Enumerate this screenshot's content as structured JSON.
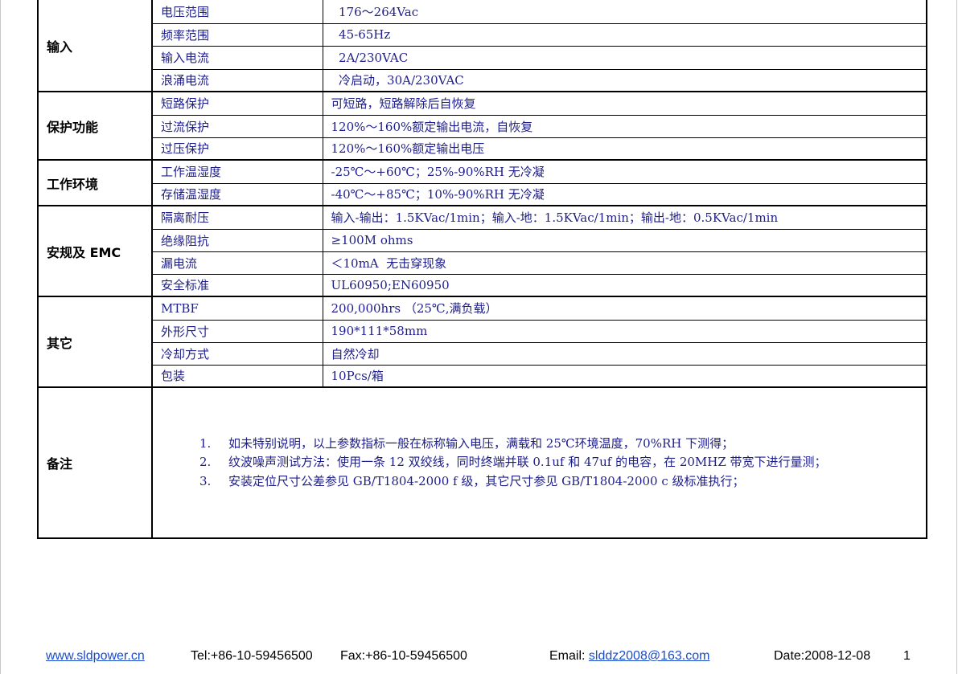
{
  "sections": [
    {
      "category": "输入",
      "rows": [
        {
          "label": "电压范围",
          "value": "  176～264Vac"
        },
        {
          "label": "频率范围",
          "value": "  45-65Hz"
        },
        {
          "label": "输入电流",
          "value": "  2A/230VAC"
        },
        {
          "label": "浪涌电流",
          "value": "  冷启动，30A/230VAC"
        }
      ]
    },
    {
      "category": "保护功能",
      "rows": [
        {
          "label": "短路保护",
          "value": "可短路，短路解除后自恢复"
        },
        {
          "label": "过流保护",
          "value": "120%～160%额定输出电流，自恢复"
        },
        {
          "label": "过压保护",
          "value": "120%～160%额定输出电压"
        }
      ]
    },
    {
      "category": "工作环境",
      "rows": [
        {
          "label": "工作温湿度",
          "value": "-25℃～+60℃；25%-90%RH 无冷凝"
        },
        {
          "label": "存储温湿度",
          "value": "-40℃～+85℃；10%-90%RH 无冷凝"
        }
      ]
    },
    {
      "category": "安规及 EMC",
      "rows": [
        {
          "label": "隔离耐压",
          "value": "输入-输出：1.5KVac/1min；输入-地：1.5KVac/1min；输出-地：0.5KVac/1min"
        },
        {
          "label": "绝缘阻抗",
          "value": "≥100M ohms"
        },
        {
          "label": "漏电流",
          "value": "＜10mA  无击穿现象"
        },
        {
          "label": "安全标准",
          "value": "UL60950;EN60950"
        }
      ]
    },
    {
      "category": "其它",
      "rows": [
        {
          "label": "MTBF",
          "value": "200,000hrs （25℃,满负载）"
        },
        {
          "label": "外形尺寸",
          "value": "190*111*58mm"
        },
        {
          "label": "冷却方式",
          "value": "自然冷却"
        },
        {
          "label": "包装",
          "value": "10Pcs/箱"
        }
      ]
    }
  ],
  "notes": {
    "category": "备注",
    "items": [
      {
        "num": "1.",
        "text": "如未特别说明，以上参数指标一般在标称输入电压，满载和 25℃环境温度，70%RH 下测得；"
      },
      {
        "num": "2.",
        "text": "纹波噪声测试方法：使用一条 12 双绞线，同时终端并联 0.1uf 和 47uf 的电容，在 20MHZ 带宽下进行量测；"
      },
      {
        "num": "3.",
        "text": "安装定位尺寸公差参见 GB/T1804-2000 f 级，其它尺寸参见 GB/T1804-2000 c 级标准执行；"
      }
    ]
  },
  "footer": {
    "website": "www.sldpower.cn",
    "tel": "Tel:+86-10-59456500",
    "fax": "Fax:+86-10-59456500",
    "email_label": "Email: ",
    "email": "slddz2008@163.com",
    "date": "Date:2008-12-08",
    "page": "1"
  }
}
